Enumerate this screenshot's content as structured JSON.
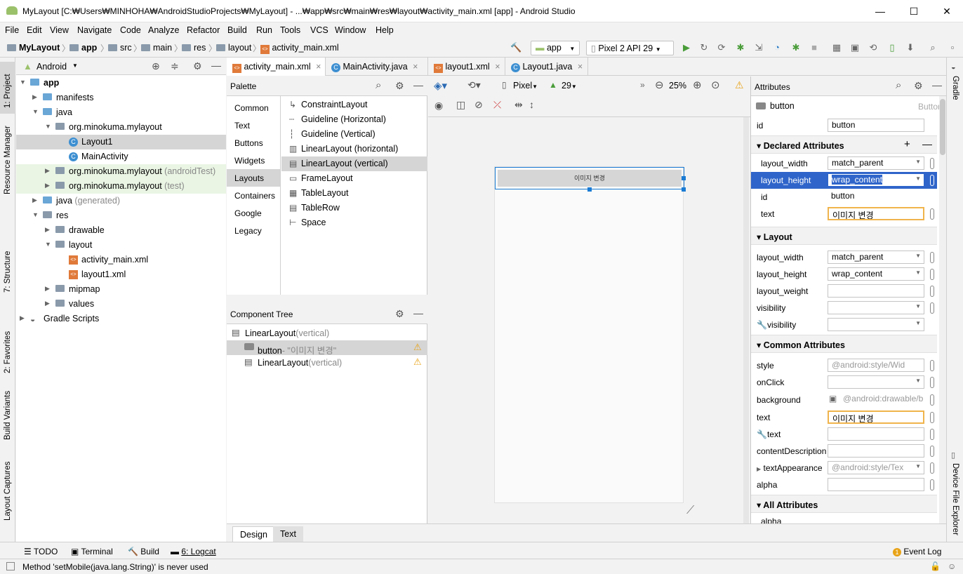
{
  "window": {
    "title": "MyLayout [C:₩Users₩MINHOHA₩AndroidStudioProjects₩MyLayout] - ...₩app₩src₩main₩res₩layout₩activity_main.xml [app] - Android Studio"
  },
  "menu": [
    "File",
    "Edit",
    "View",
    "Navigate",
    "Code",
    "Analyze",
    "Refactor",
    "Build",
    "Run",
    "Tools",
    "VCS",
    "Window",
    "Help"
  ],
  "breadcrumb": [
    "MyLayout",
    "app",
    "src",
    "main",
    "res",
    "layout",
    "activity_main.xml"
  ],
  "toolbar": {
    "run_config": "app",
    "device": "Pixel 2 API 29"
  },
  "left_strip": [
    "1: Project",
    "Resource Manager",
    "7: Structure",
    "2: Favorites",
    "Build Variants",
    "Layout Captures"
  ],
  "right_strip": [
    "Gradle",
    "Device File Explorer"
  ],
  "project": {
    "view": "Android",
    "tree": [
      {
        "label": "app",
        "suffix": "",
        "bold": true
      },
      {
        "label": "manifests",
        "suffix": ""
      },
      {
        "label": "java",
        "suffix": ""
      },
      {
        "label": "org.minokuma.mylayout",
        "suffix": ""
      },
      {
        "label": "Layout1",
        "suffix": ""
      },
      {
        "label": "MainActivity",
        "suffix": ""
      },
      {
        "label": "org.minokuma.mylayout",
        "suffix": " (androidTest)"
      },
      {
        "label": "org.minokuma.mylayout",
        "suffix": " (test)"
      },
      {
        "label": "java",
        "suffix": " (generated)"
      },
      {
        "label": "res",
        "suffix": ""
      },
      {
        "label": "drawable",
        "suffix": ""
      },
      {
        "label": "layout",
        "suffix": ""
      },
      {
        "label": "activity_main.xml",
        "suffix": ""
      },
      {
        "label": "layout1.xml",
        "suffix": ""
      },
      {
        "label": "mipmap",
        "suffix": ""
      },
      {
        "label": "values",
        "suffix": ""
      },
      {
        "label": "Gradle Scripts",
        "suffix": ""
      }
    ]
  },
  "tabs": [
    "activity_main.xml",
    "MainActivity.java",
    "layout1.xml",
    "Layout1.java"
  ],
  "palette": {
    "title": "Palette",
    "categories": [
      "Common",
      "Text",
      "Buttons",
      "Widgets",
      "Layouts",
      "Containers",
      "Google",
      "Legacy"
    ],
    "items": [
      "ConstraintLayout",
      "Guideline (Horizontal)",
      "Guideline (Vertical)",
      "LinearLayout (horizontal)",
      "LinearLayout (vertical)",
      "FrameLayout",
      "TableLayout",
      "TableRow",
      "Space"
    ]
  },
  "component_tree": {
    "title": "Component Tree",
    "rows": [
      {
        "name": "LinearLayout",
        "detail": "(vertical)"
      },
      {
        "name": "button",
        "detail": "- \"이미지 변경\""
      },
      {
        "name": "LinearLayout",
        "detail": "(vertical)"
      }
    ]
  },
  "design_toolbar": {
    "device": "Pixel",
    "api": "29",
    "zoom": "25%"
  },
  "preview": {
    "button_text": "이미지 변경"
  },
  "bottom_tabs": [
    "Design",
    "Text"
  ],
  "attributes": {
    "title": "Attributes",
    "component": "button",
    "component_type": "Button",
    "id_label": "id",
    "id_value": "button",
    "declared_title": "Declared Attributes",
    "declared": [
      {
        "name": "layout_width",
        "value": "match_parent"
      },
      {
        "name": "layout_height",
        "value": "wrap_content"
      },
      {
        "name": "id",
        "value": "button"
      },
      {
        "name": "text",
        "value": "이미지 변경"
      }
    ],
    "layout_title": "Layout",
    "layout": [
      {
        "name": "layout_width",
        "value": "match_parent"
      },
      {
        "name": "layout_height",
        "value": "wrap_content"
      },
      {
        "name": "layout_weight",
        "value": ""
      },
      {
        "name": "visibility",
        "value": ""
      },
      {
        "name": "visibility",
        "value": ""
      }
    ],
    "common_title": "Common Attributes",
    "common": [
      {
        "name": "style",
        "value": "@android:style/Wid"
      },
      {
        "name": "onClick",
        "value": ""
      },
      {
        "name": "background",
        "value": "@android:drawable/b"
      },
      {
        "name": "text",
        "value": "이미지 변경"
      },
      {
        "name": "text",
        "value": ""
      },
      {
        "name": "contentDescription",
        "value": ""
      },
      {
        "name": "textAppearance",
        "value": "@android:style/Tex"
      },
      {
        "name": "alpha",
        "value": ""
      }
    ],
    "all_title": "All Attributes",
    "all_first": "alpha"
  },
  "toolwindows": [
    "TODO",
    "Terminal",
    "Build",
    "6: Logcat"
  ],
  "event_log": {
    "count": "1",
    "label": "Event Log"
  },
  "status": "Method 'setMobile(java.lang.String)' is never used"
}
